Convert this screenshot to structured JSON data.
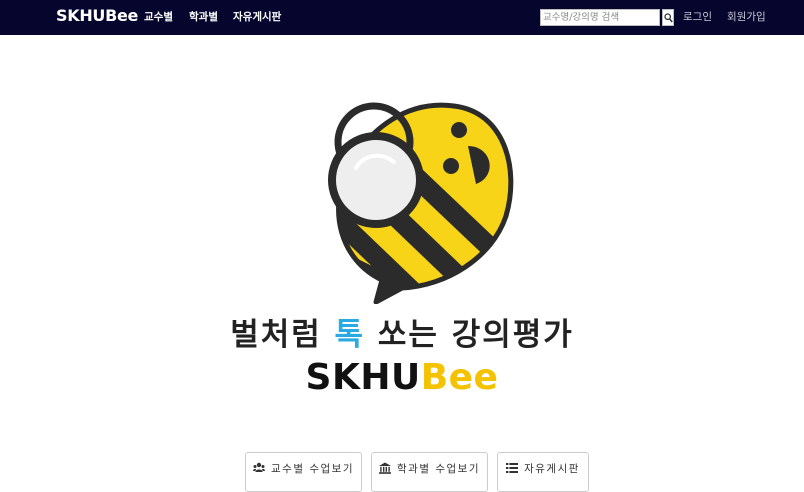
{
  "navbar": {
    "brand": "SKHUBee",
    "links": [
      "교수별",
      "학과별",
      "자유게시판"
    ],
    "search_placeholder": "교수명/강의명 검색",
    "login": "로그인",
    "signup": "회원가입"
  },
  "hero": {
    "slogan_prefix": "벌처럼 ",
    "slogan_accent": "톡",
    "slogan_suffix": " 쏘는 강의평가",
    "brand_part1": "SKHU",
    "brand_part2": "Bee"
  },
  "buttons": [
    {
      "label": "교수별 수업보기",
      "icon": "users-icon"
    },
    {
      "label": "학과별 수업보기",
      "icon": "bank-icon"
    },
    {
      "label": "자유게시판",
      "icon": "list-icon"
    }
  ],
  "colors": {
    "navbar_bg": "#05052e",
    "accent_blue": "#29abe2",
    "accent_yellow": "#f5c200",
    "bee_yellow": "#f7d417",
    "bee_dark": "#2b2b2b"
  }
}
